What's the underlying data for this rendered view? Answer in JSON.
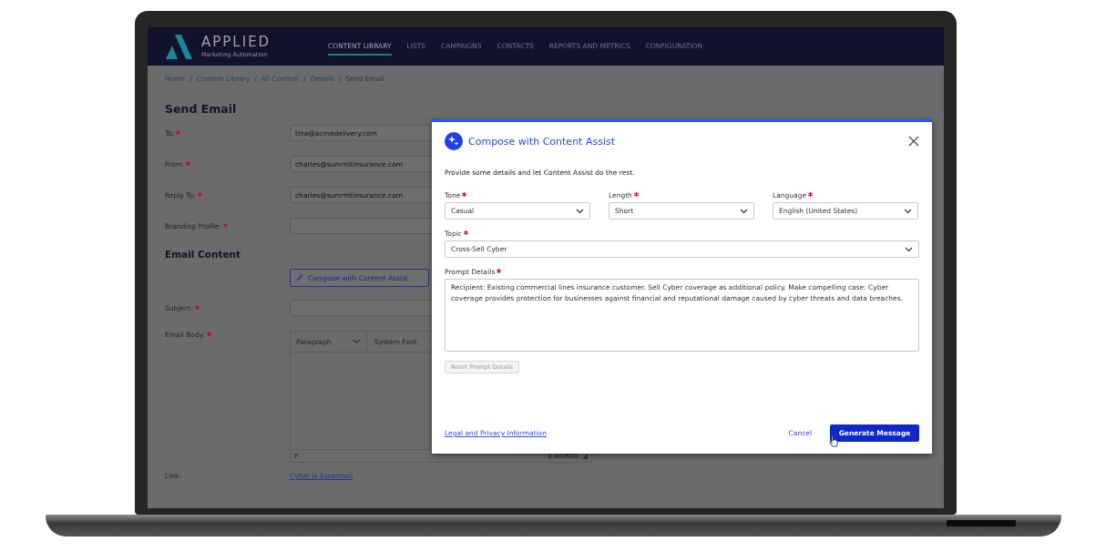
{
  "nav": {
    "logo": {
      "name": "APPLIED",
      "tagline": "Marketing Automation"
    },
    "items": [
      {
        "label": "CONTENT LIBRARY",
        "selected": true
      },
      {
        "label": "LISTS",
        "selected": false
      },
      {
        "label": "CAMPAIGNS",
        "selected": false
      },
      {
        "label": "CONTACTS",
        "selected": false
      },
      {
        "label": "REPORTS AND METRICS",
        "selected": false
      },
      {
        "label": "CONFIGURATION",
        "selected": false
      }
    ]
  },
  "breadcrumbs": [
    {
      "kind": "link",
      "label": "Home"
    },
    {
      "kind": "separator",
      "label": "/"
    },
    {
      "kind": "link",
      "label": "Content Library"
    },
    {
      "kind": "separator",
      "label": "/"
    },
    {
      "kind": "link",
      "label": "All Content"
    },
    {
      "kind": "separator",
      "label": "/"
    },
    {
      "kind": "link",
      "label": "Details"
    },
    {
      "kind": "separator",
      "label": "/"
    },
    {
      "kind": "current",
      "label": "Send Email"
    }
  ],
  "page_title": "Send Email",
  "fields": [
    {
      "label": "To:",
      "required": true,
      "value": "tina@acmedelivery.com"
    },
    {
      "label": "From:",
      "required": true,
      "value": "charles@summitinsurance.com"
    },
    {
      "label": "Reply To:",
      "required": true,
      "value": "charles@summitinsurance.com"
    },
    {
      "label": "Branding Profile:",
      "required": true
    }
  ],
  "email_content": {
    "heading": "Email Content",
    "compose_button": "Compose with Content Assist",
    "subject": {
      "label": "Subject:",
      "required": true
    },
    "body": {
      "label": "Email Body:",
      "required": true,
      "block_format": "Paragraph",
      "font": "System Font",
      "path": "P",
      "word_count": "0 WORDS"
    }
  },
  "link": {
    "label": "Link:",
    "value": "Cyber is Essential!"
  },
  "dialog": {
    "title": "Compose with Content Assist",
    "intro": "Provide some details and let Content Assist do the rest.",
    "selects": [
      {
        "label": "Tone",
        "required": true,
        "value": "Casual"
      },
      {
        "label": "Length",
        "required": true,
        "value": "Short"
      },
      {
        "label": "Language",
        "required": true,
        "value": "English (United States)"
      }
    ],
    "topic": {
      "label": "Topic",
      "required": true,
      "value": "Cross-Sell Cyber"
    },
    "prompt": {
      "label": "Prompt Details",
      "required": true,
      "value": "Recipient: Existing commercial lines insurance customer. Sell Cyber coverage as additional policy. Make compelling case: Cyber coverage provides protection for businesses against financial and reputational damage caused by cyber threats and data breaches."
    },
    "reset_button": {
      "label": "Reset Prompt Details",
      "disabled": true
    },
    "legal_link": "Legal and Privacy Information",
    "cancel": "Cancel",
    "generate": "Generate Message"
  }
}
